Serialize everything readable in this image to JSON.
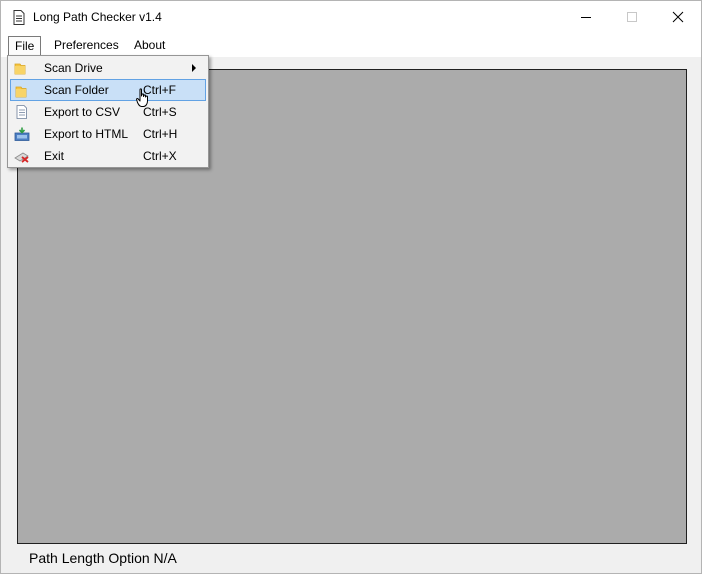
{
  "window": {
    "title": "Long Path Checker v1.4"
  },
  "menubar": {
    "items": [
      {
        "label": "File"
      },
      {
        "label": "Preferences"
      },
      {
        "label": "About"
      }
    ]
  },
  "file_menu": {
    "items": [
      {
        "label": "Scan Drive",
        "shortcut": "",
        "icon": "folder-icon",
        "submenu": true
      },
      {
        "label": "Scan Folder",
        "shortcut": "Ctrl+F",
        "icon": "folder-icon",
        "highlighted": true
      },
      {
        "label": "Export to CSV",
        "shortcut": "Ctrl+S",
        "icon": "document-icon"
      },
      {
        "label": "Export to HTML",
        "shortcut": "Ctrl+H",
        "icon": "export-html-icon"
      },
      {
        "label": "Exit",
        "shortcut": "Ctrl+X",
        "icon": "exit-icon"
      }
    ]
  },
  "status": {
    "text": "Path Length Option N/A"
  },
  "colors": {
    "canvas": "#ababab",
    "highlight": "#c9e0f7",
    "highlight_border": "#62a2e4",
    "folder": "#f5c542"
  }
}
